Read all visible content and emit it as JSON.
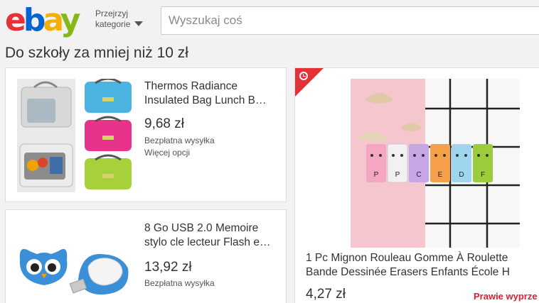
{
  "header": {
    "logo_text": [
      "e",
      "b",
      "a",
      "y"
    ],
    "category_label": [
      "Przejrzyj",
      "kategorie"
    ],
    "search_placeholder": "Wyszukaj coś"
  },
  "section": {
    "title": "Do szkoły za mniej niż 10 zł"
  },
  "products": [
    {
      "title": [
        "Thermos Radiance",
        "Insulated Bag Lunch B…"
      ],
      "price": "9,68 zł",
      "shipping": "Bezpłatna wysyłka",
      "more": "Więcej opcji"
    },
    {
      "title": [
        "8 Go USB 2.0 Memoire",
        "stylo cle lecteur Flash e…"
      ],
      "price": "13,92 zł",
      "shipping": "Bezpłatna wysyłka"
    },
    {
      "title": [
        "1 Pc Mignon Rouleau Gomme À Roulette",
        "Bande Dessinée Erasers Enfants École H"
      ],
      "price": "4,27 zł",
      "deal_label": "Prawie wyprze",
      "eraser_labels": [
        "P",
        "P",
        "C",
        "E",
        "D",
        "F"
      ]
    }
  ],
  "colors": {
    "ebay_red": "#e53238",
    "ebay_blue": "#0064d2",
    "ebay_yellow": "#f5af02",
    "ebay_green": "#86b817",
    "deal_red": "#dd1e31"
  }
}
